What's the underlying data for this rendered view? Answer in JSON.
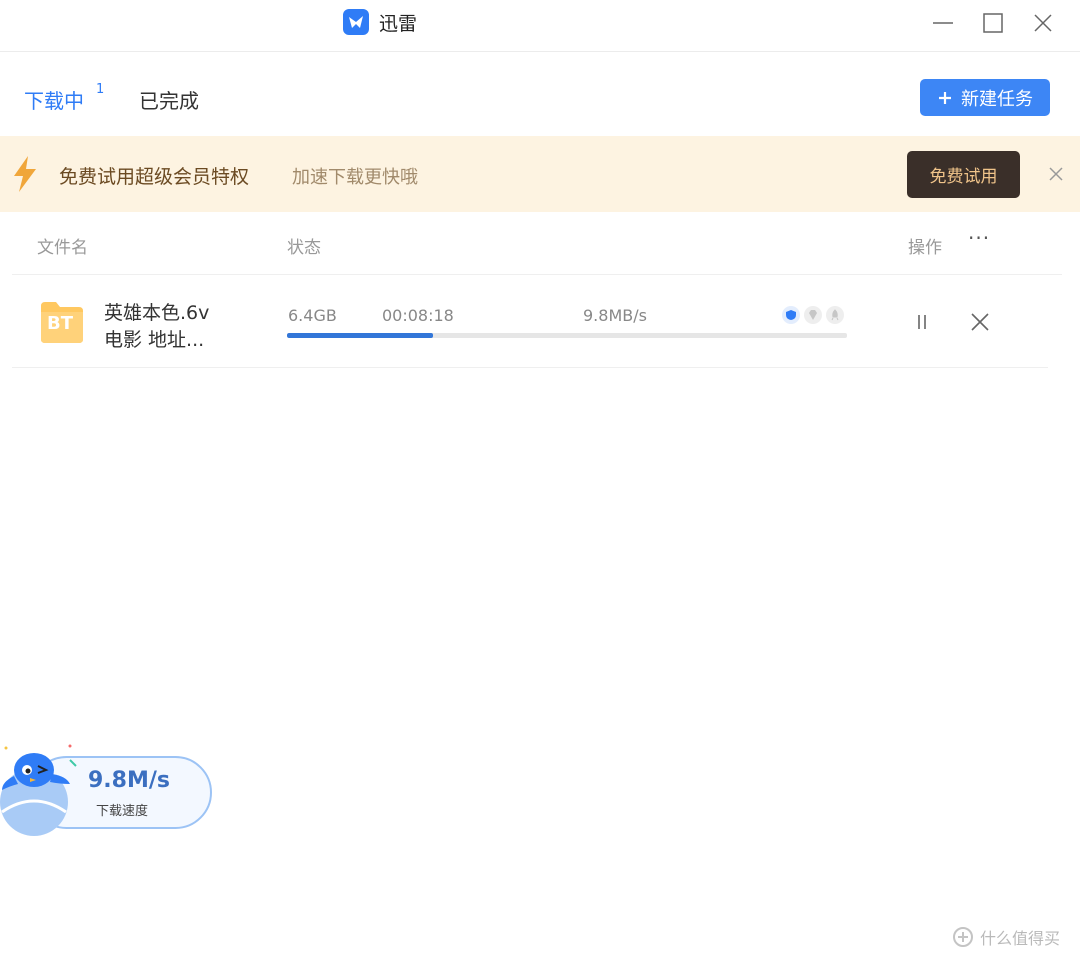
{
  "window": {
    "title": "迅雷"
  },
  "tabs": {
    "downloading": "下载中",
    "downloading_count": "1",
    "completed": "已完成"
  },
  "toolbar": {
    "new_task_label": "新建任务"
  },
  "promo": {
    "text": "免费试用超级会员特权",
    "subtext": "加速下载更快哦",
    "button_label": "免费试用"
  },
  "table": {
    "headers": {
      "file": "文件名",
      "status": "状态",
      "actions": "操作",
      "more": "···"
    },
    "rows": [
      {
        "icon_label": "BT",
        "name": "英雄本色.6v",
        "subtitle": "电影 地址...",
        "size": "6.4GB",
        "time_left": "00:08:18",
        "speed": "9.8MB/s",
        "progress": 0.26
      }
    ]
  },
  "speed_widget": {
    "value": "9.8M/s",
    "label": "下载速度"
  },
  "watermark": {
    "text": "什么值得买"
  },
  "colors": {
    "accent": "#2f7cf6",
    "promo_bg": "#fdf3e1",
    "promo_button": "#3a2f29",
    "progress": "#3276d8"
  }
}
